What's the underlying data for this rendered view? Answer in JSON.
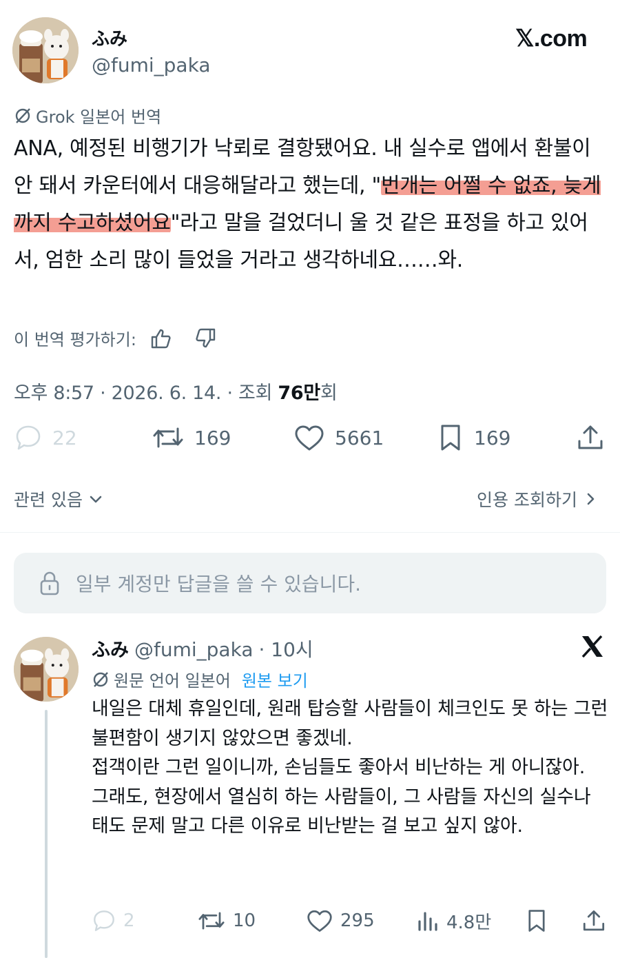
{
  "post": {
    "author_name": "ふみ",
    "author_handle": "@fumi_paka",
    "site_logo": "𝕏.com",
    "translation_label": "Grok 일본어 번역",
    "text_before": "ANA, 예정된 비행기가 낙뢰로 결항됐어요. 내 실수로 앱에서 환불이 안 돼서 카운터에서 대응해달라고 했는데, \"",
    "text_highlight": "번개는 어쩔 수 없죠, 늦게까지 수고하셨어요",
    "text_after": "\"라고 말을 걸었더니 울 것 같은 표정을 하고 있어서, 엄한 소리 많이 들었을 거라고 생각하네요……와.",
    "rate_label": "이 번역 평가하기:",
    "meta_prefix": "오후 8:57 · 2026. 6. 14. · 조회 ",
    "views_bold": "76만",
    "views_suffix": "회",
    "actions": {
      "replies": "22",
      "reposts": "169",
      "likes": "5661",
      "bookmarks": "169"
    },
    "related_label": "관련 있음",
    "quotes_label": "인용 조회하기"
  },
  "reply_restriction": "일부 계정만 답글을 쓸 수 있습니다.",
  "reply": {
    "author_name": "ふみ",
    "author_handle": "@fumi_paka",
    "time": "· 10시",
    "source_lang": "원문 언어 일본어",
    "view_original": "원본 보기",
    "text": "내일은 대체 휴일인데, 원래 탑승할 사람들이 체크인도 못 하는 그런 불편함이 생기지 않았으면 좋겠네.\n접객이란 그런 일이니까, 손님들도 좋아서 비난하는 게 아니잖아.\n그래도, 현장에서 열심히 하는 사람들이, 그 사람들 자신의 실수나 태도 문제 말고 다른 이유로 비난받는 걸 보고 싶지 않아.",
    "actions": {
      "replies": "2",
      "reposts": "10",
      "likes": "295",
      "views": "4.8만"
    }
  },
  "colors": {
    "text": "#0f1419",
    "secondary": "#536471",
    "link": "#1d9bf0",
    "highlight": "#f07869",
    "panel": "#eff3f4"
  }
}
